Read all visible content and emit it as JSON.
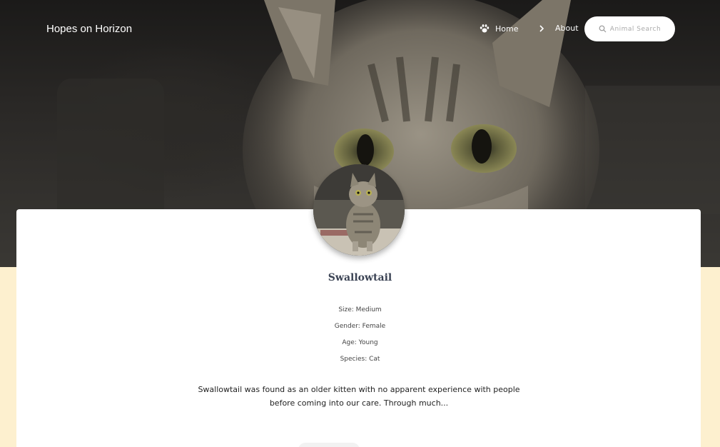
{
  "navbar": {
    "brand": "Hopes on Horizon",
    "home_label": "Home",
    "about_label": "About",
    "search_label": "Animal Search",
    "icons": {
      "home": "paw-icon",
      "about": "chevron-right-icon",
      "search": "search-icon"
    }
  },
  "pet": {
    "name": "Swallowtail",
    "size": "Size: Medium",
    "gender": "Gender: Female",
    "age": "Age: Young",
    "species": "Species: Cat",
    "description": "Swallowtail was found as an older kitten with no apparent experience with people before coming into our care. Through much..."
  },
  "colors": {
    "page_background": "#fdf0cf",
    "card_background": "#ffffff",
    "name_color": "#3b4354"
  }
}
